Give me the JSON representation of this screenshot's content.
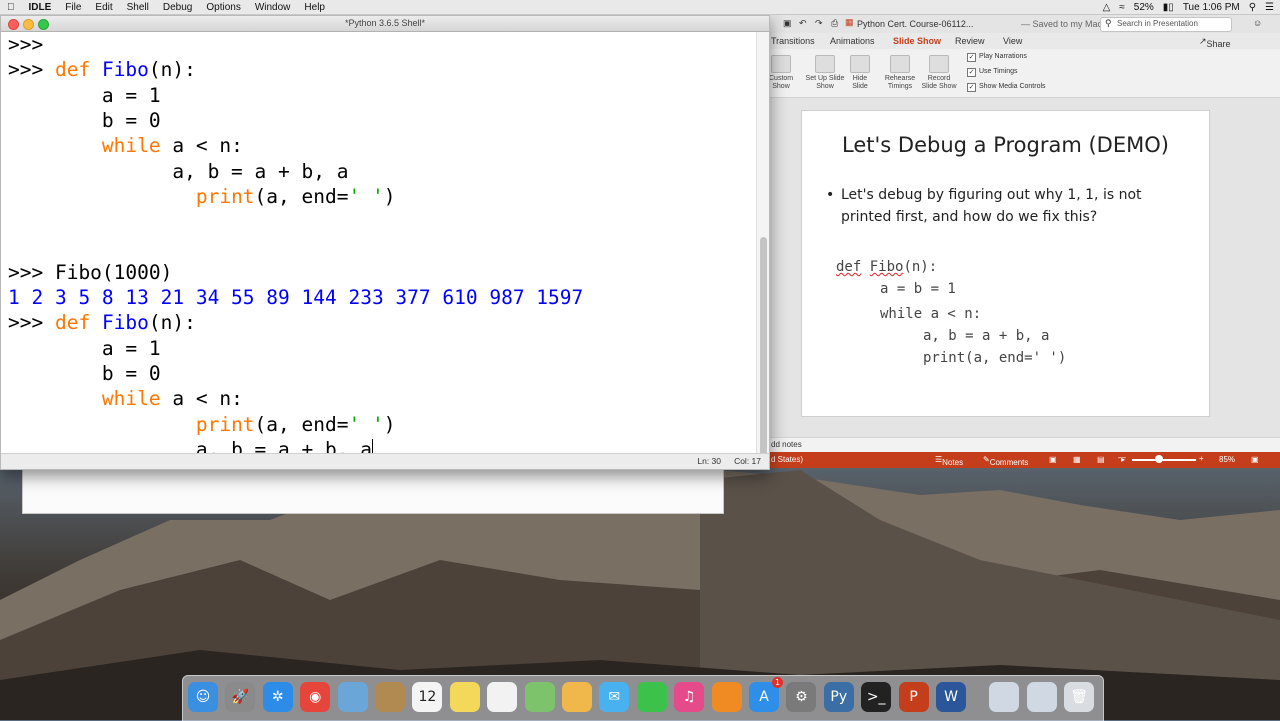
{
  "menubar": {
    "apple": "",
    "app_name": "IDLE",
    "items": [
      "File",
      "Edit",
      "Shell",
      "Debug",
      "Options",
      "Window",
      "Help"
    ],
    "battery": "52%",
    "clock": "Tue 1:06 PM"
  },
  "idle_window": {
    "title": "*Python 3.6.5 Shell*",
    "status_line": "Ln: 30",
    "status_col": "Col: 17",
    "code_lines": [
      {
        "t": "prompt",
        "text": ">>>"
      },
      {
        "t": "def",
        "prompt": ">>> ",
        "kw": "def",
        "fn": "Fibo",
        "rest": "(n):"
      },
      {
        "t": "plain",
        "indent": "      ",
        "text": "a = 1"
      },
      {
        "t": "plain",
        "indent": "      ",
        "text": "b = 0"
      },
      {
        "t": "while",
        "indent": "      ",
        "kw": "while",
        "rest": " a < n:"
      },
      {
        "t": "plain",
        "indent": "            ",
        "text": "a, b = a + b, a"
      },
      {
        "t": "print",
        "indent": "            ",
        "kw": "print",
        "mid": "(a, end=",
        "str": "' '",
        "end": ")"
      },
      {
        "t": "plain",
        "indent": "",
        "text": ""
      },
      {
        "t": "plain",
        "indent": "",
        "text": ""
      },
      {
        "t": "call",
        "prompt": ">>> ",
        "text": "Fibo(1000)"
      },
      {
        "t": "out",
        "text": "1 2 3 5 8 13 21 34 55 89 144 233 377 610 987 1597"
      },
      {
        "t": "def",
        "prompt": ">>> ",
        "kw": "def",
        "fn": "Fibo",
        "rest": "(n):"
      },
      {
        "t": "plain",
        "indent": "      ",
        "text": "a = 1"
      },
      {
        "t": "plain",
        "indent": "      ",
        "text": "b = 0"
      },
      {
        "t": "while",
        "indent": "      ",
        "kw": "while",
        "rest": " a < n:"
      },
      {
        "t": "print",
        "indent": "            ",
        "kw": "print",
        "mid": "(a, end=",
        "str": "' '",
        "end": ")"
      },
      {
        "t": "last",
        "indent": "            ",
        "text": "a, b = a + b, a"
      }
    ]
  },
  "ppt": {
    "title": "Python Cert. Course-06112...",
    "saved": "— Saved to my Mac",
    "search_placeholder": "Search in Presentation",
    "tabs": [
      "Transitions",
      "Animations",
      "Slide Show",
      "Review",
      "View"
    ],
    "active_tab": "Slide Show",
    "share": "Share",
    "ribbon_buttons": [
      "Custom Show",
      "Set Up Slide Show",
      "Hide Slide",
      "Rehearse Timings",
      "Record Slide Show"
    ],
    "checkboxes": [
      "Play Narrations",
      "Use Timings",
      "Show Media Controls"
    ],
    "slide": {
      "title": "Let's Debug a Program (DEMO)",
      "bullet": "Let's debug by figuring out why 1, 1, is not printed first, and how do we fix this?",
      "code": [
        "def Fibo(n):",
        "a = b = 1",
        "while a < n:",
        "a, b = a + b, a",
        "print(a, end=' ')"
      ]
    },
    "notes_label": "dd notes",
    "status_left": "d States)",
    "status_notes": "Notes",
    "status_comments": "Comments",
    "zoom": "85%"
  },
  "dock": {
    "items": [
      "finder-icon",
      "launchpad-icon",
      "safari-icon",
      "chrome-icon",
      "preview-icon",
      "contacts-icon",
      "calendar-icon",
      "notes-icon",
      "reminders-icon",
      "maps-icon",
      "photos-icon",
      "messages-icon",
      "facetime-icon",
      "itunes-icon",
      "ibooks-icon",
      "appstore-icon",
      "system-preferences-icon",
      "python-icon",
      "terminal-icon",
      "powerpoint-icon",
      "word-icon",
      "finder-folder-icon",
      "downloads-icon",
      "trash-icon"
    ],
    "calendar_day": "12",
    "appstore_badge": "1"
  }
}
